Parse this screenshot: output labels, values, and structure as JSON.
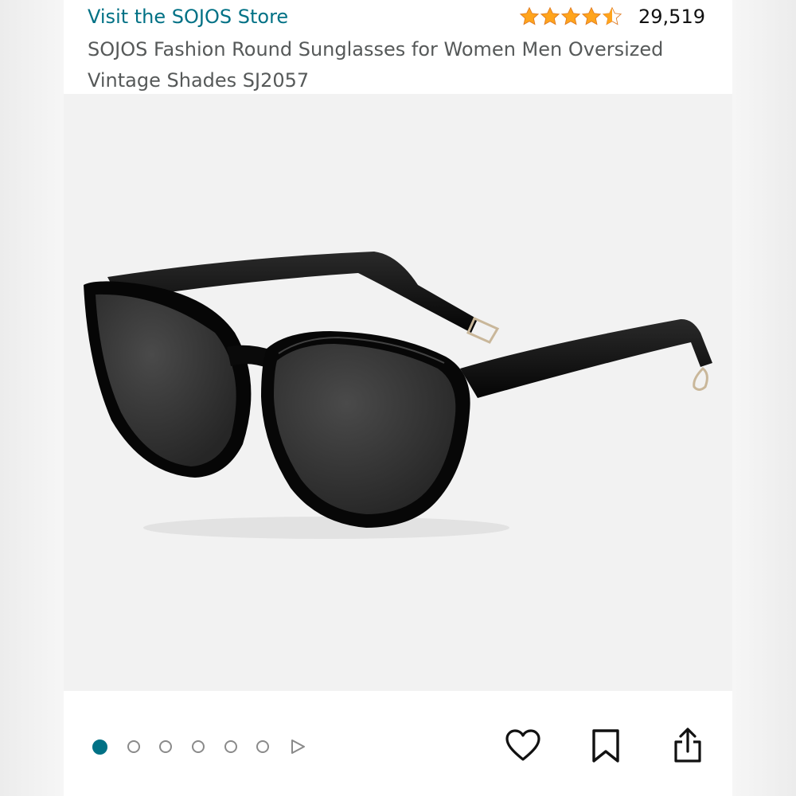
{
  "header": {
    "store_link": "Visit the SOJOS Store",
    "rating": 4.5,
    "review_count": "29,519",
    "product_title": "SOJOS Fashion Round Sunglasses for Women Men Oversized Vintage Shades SJ2057"
  },
  "gallery": {
    "image_subject": "black round oversized sunglasses",
    "total_images": 6,
    "active_index": 0,
    "has_more_arrow": true
  },
  "actions": {
    "icons": [
      "heart-icon",
      "bookmark-icon",
      "share-icon"
    ]
  },
  "colors": {
    "link": "#007185",
    "star": "#FFA41C",
    "title": "#565959",
    "active_dot": "#007185"
  }
}
